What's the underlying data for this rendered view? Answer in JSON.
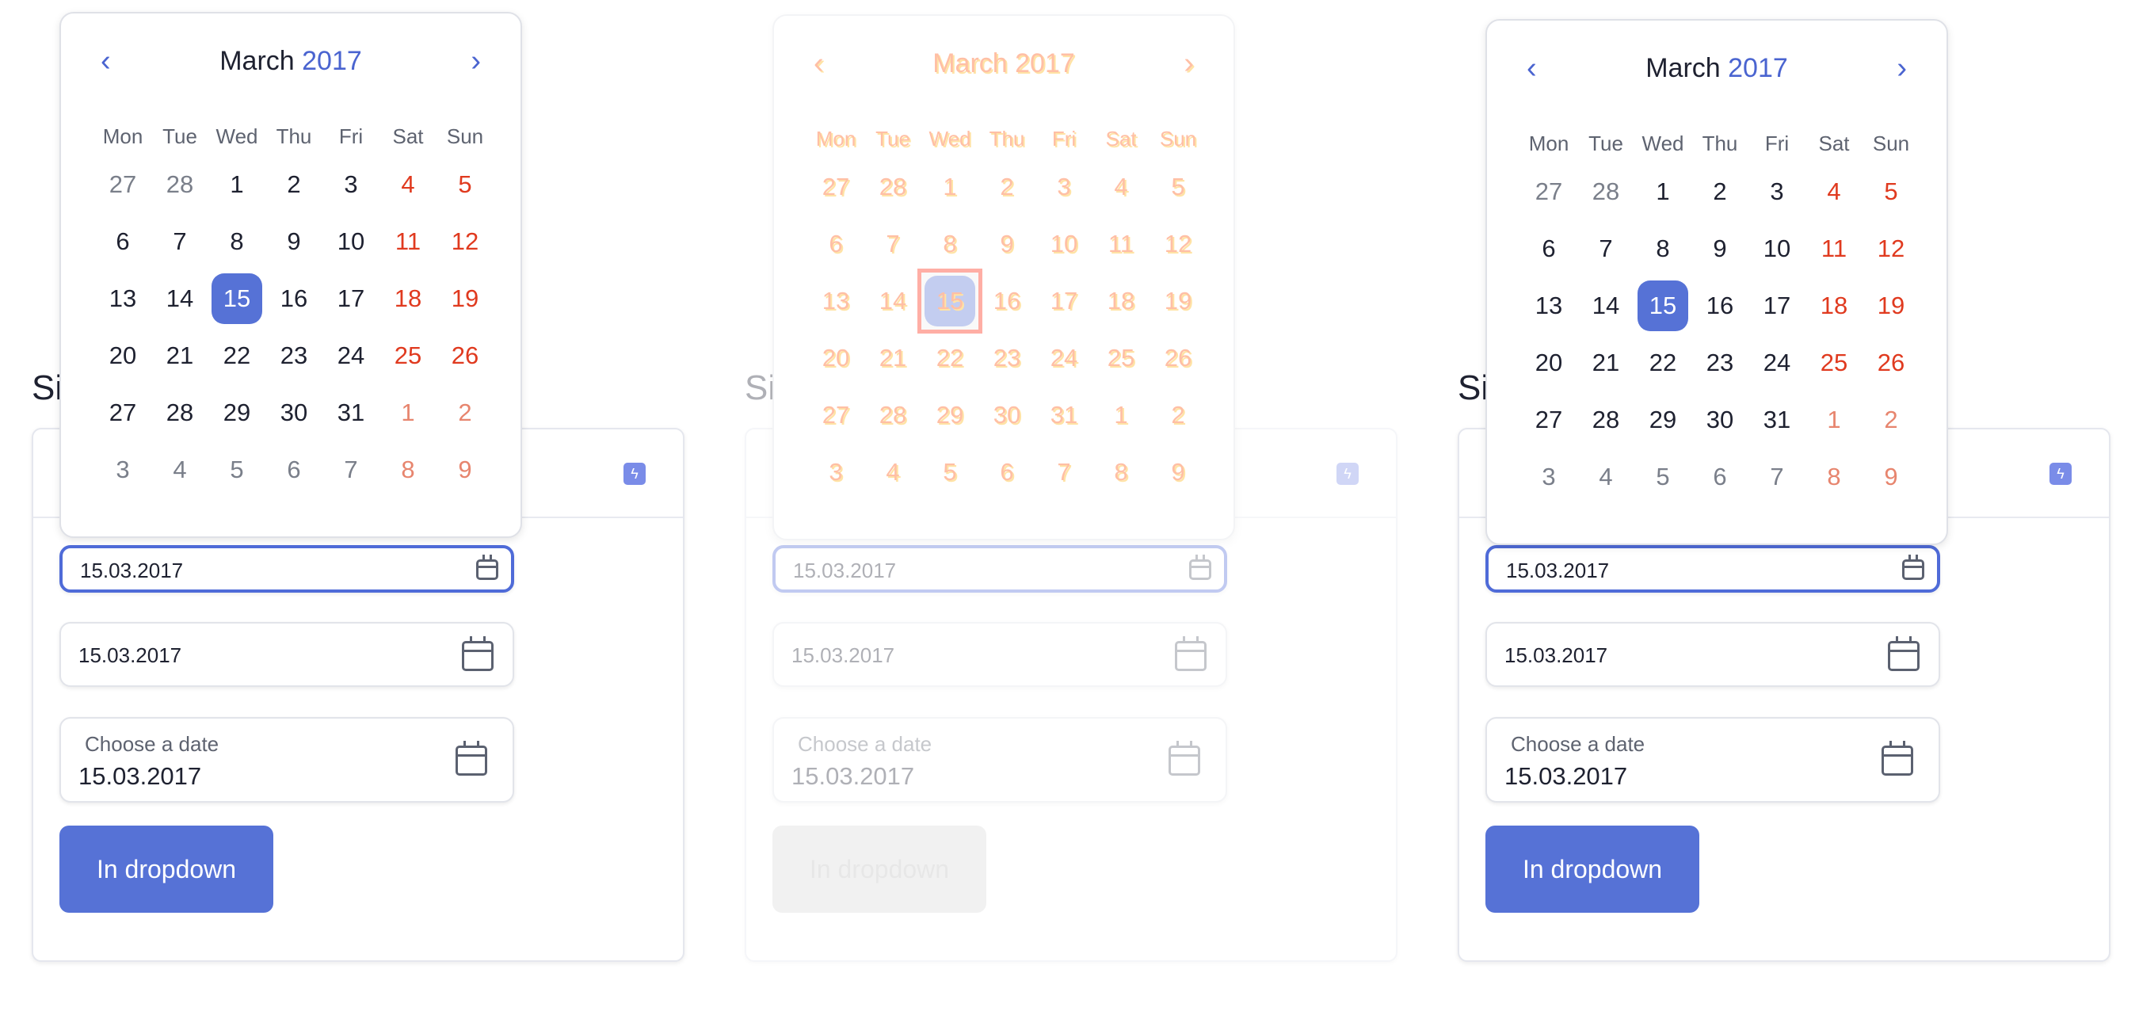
{
  "section_title": "Si",
  "calendar": {
    "prev_icon": "chevron-left-icon",
    "next_icon": "chevron-right-icon",
    "month": "March",
    "year": "2017",
    "weekdays": [
      "Mon",
      "Tue",
      "Wed",
      "Thu",
      "Fri",
      "Sat",
      "Sun"
    ],
    "days": [
      [
        "27",
        "28",
        "1",
        "2",
        "3",
        "4",
        "5"
      ],
      [
        "6",
        "7",
        "8",
        "9",
        "10",
        "11",
        "12"
      ],
      [
        "13",
        "14",
        "15",
        "16",
        "17",
        "18",
        "19"
      ],
      [
        "20",
        "21",
        "22",
        "23",
        "24",
        "25",
        "26"
      ],
      [
        "27",
        "28",
        "29",
        "30",
        "31",
        "1",
        "2"
      ],
      [
        "3",
        "4",
        "5",
        "6",
        "7",
        "8",
        "9"
      ]
    ],
    "selected_day": "15"
  },
  "fields": {
    "date1_value": "15.03.2017",
    "date2_value": "15.03.2017",
    "date3_label": "Choose a date",
    "date3_value": "15.03.2017"
  },
  "button": {
    "label": "In dropdown"
  },
  "icons": {
    "card_action": "bolt-icon",
    "field": "calendar-icon"
  },
  "colors": {
    "accent": "#5672d6",
    "weekend": "#e03a1f"
  }
}
